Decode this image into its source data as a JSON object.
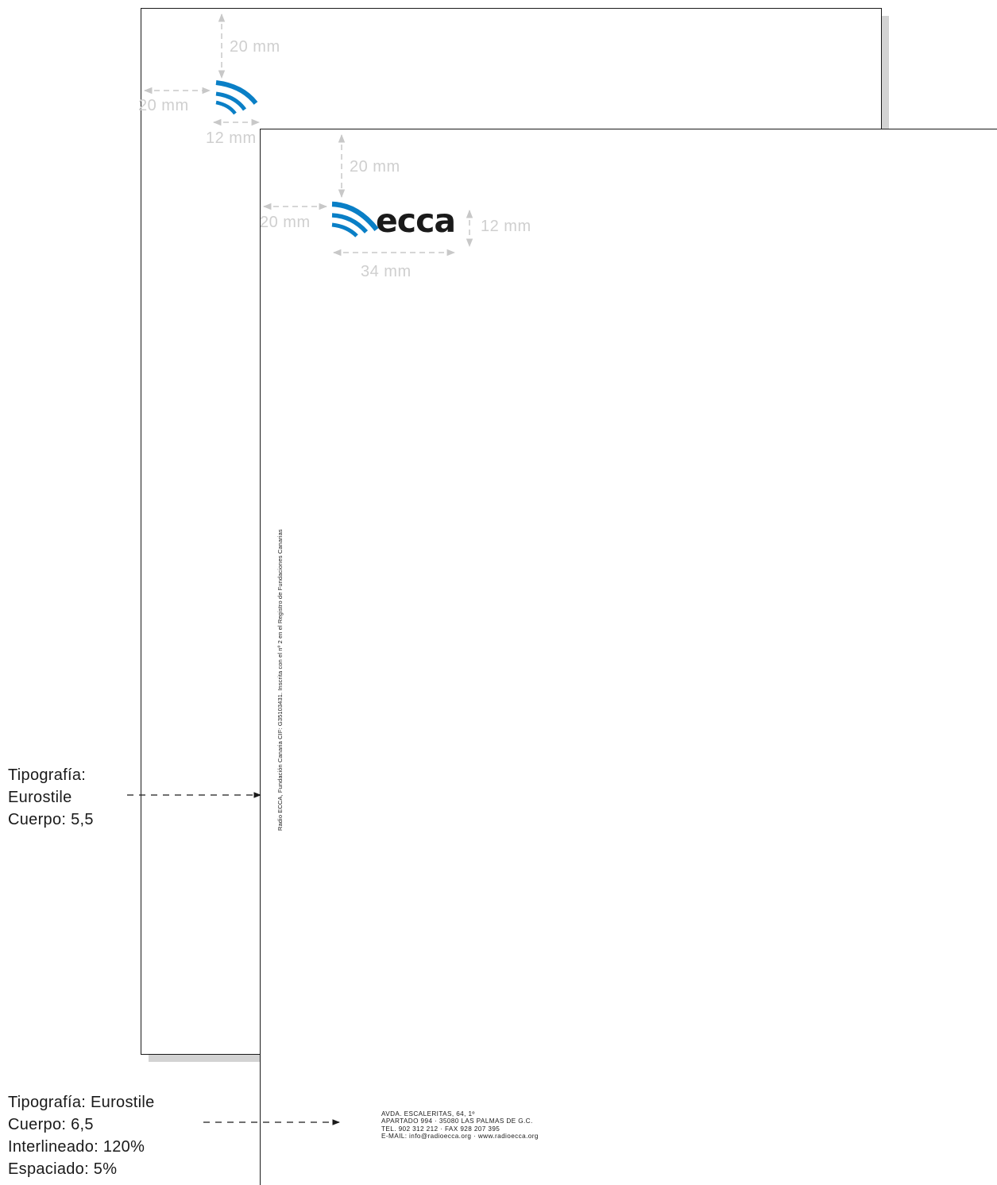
{
  "colors": {
    "brand_blue": "#0a7fc6",
    "guide_gray": "#c8c8c8",
    "ink": "#1a1a1a",
    "shadow": "#d3d3d3"
  },
  "back_sheet": {
    "dim_top": "20 mm",
    "dim_left": "20 mm",
    "dim_logo_width": "12 mm",
    "logo": "ecca-waves-icon"
  },
  "front_sheet": {
    "dim_top": "20 mm",
    "dim_left": "20 mm",
    "dim_logo_height": "12 mm",
    "dim_logo_width": "34 mm",
    "logo_text": "ecca",
    "vertical_legal_text": "Radio ECCA, Fundación Canaria CIF: G35103431. Inscrita con el nº 2 en el Registro de Fundaciones Canarias",
    "address_lines": [
      "AVDA. ESCALERITAS, 64, 1º",
      "APARTADO 994 · 35080 LAS PALMAS DE G.C.",
      "TEL. 902 312 212 · FAX 928 207 395",
      "E-MAIL: info@radioecca.org · www.radioecca.org"
    ]
  },
  "notes": {
    "vertical_text_spec": [
      "Tipografía:",
      "Eurostile",
      "Cuerpo: 5,5"
    ],
    "address_spec": [
      "Tipografía: Eurostile",
      "Cuerpo: 6,5",
      "Interlineado: 120%",
      "Espaciado: 5%"
    ]
  }
}
